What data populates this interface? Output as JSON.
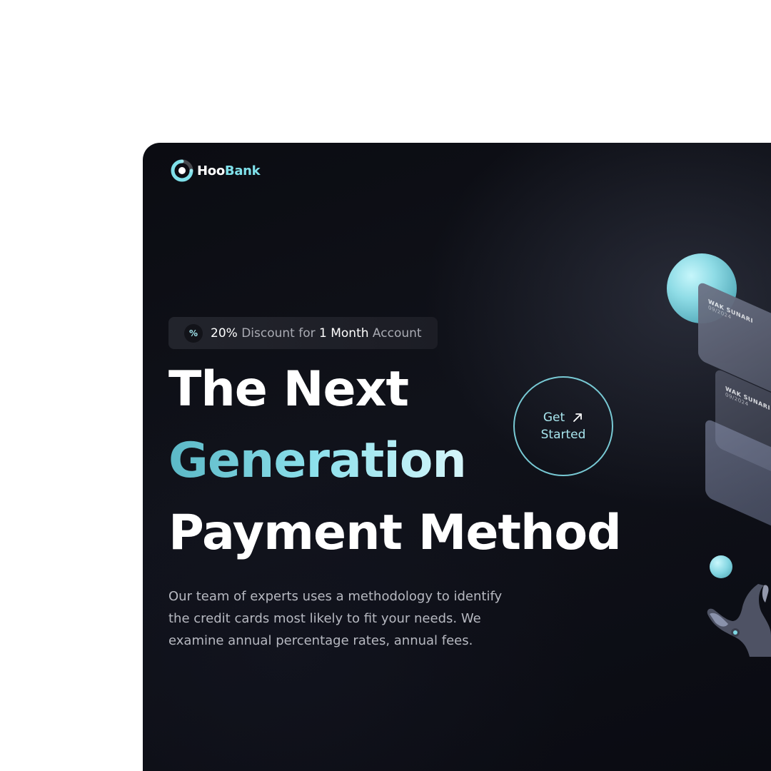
{
  "brand": {
    "name_part1": "Hoo",
    "name_part2": "Bank"
  },
  "badge": {
    "icon": "percent-icon",
    "parts": [
      "20%",
      " Discount for ",
      "1 Month",
      " Account"
    ]
  },
  "headline": {
    "line1": "The Next",
    "line2": "Generation",
    "line3": "Payment Method"
  },
  "cta": {
    "line1": "Get",
    "line2": "Started",
    "icon": "arrow-up-right-icon"
  },
  "description": "Our team of experts uses a methodology to identify the credit cards most likely to fit your needs. We examine annual percentage rates, annual fees.",
  "cards": [
    {
      "holder": "WAK SUNARI",
      "expiry": "09/2024"
    },
    {
      "holder": "WAK SUNARI",
      "expiry": "09/2024"
    }
  ],
  "colors": {
    "background": "#0b0c12",
    "accent": "#7fe0ea",
    "gradient_start": "#5bb8c6",
    "gradient_end": "#d6f6fa"
  }
}
